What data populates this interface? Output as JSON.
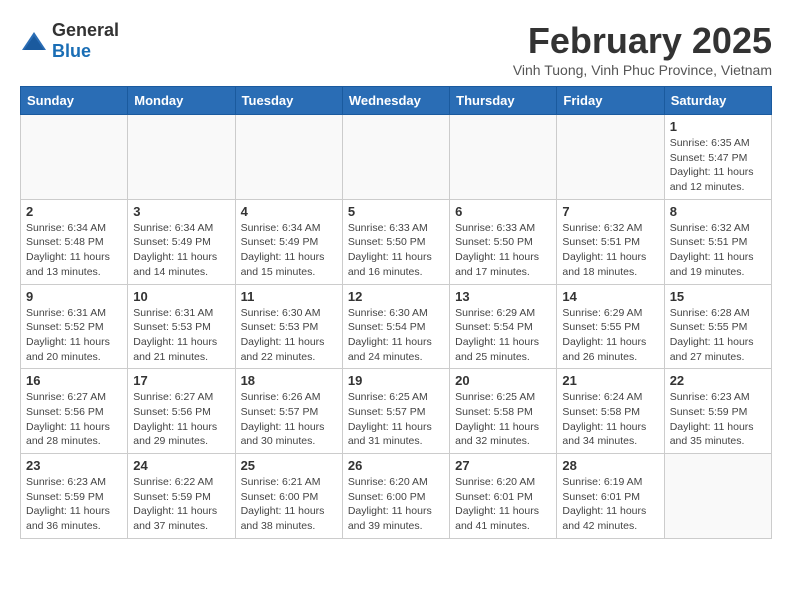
{
  "logo": {
    "general": "General",
    "blue": "Blue"
  },
  "title": "February 2025",
  "subtitle": "Vinh Tuong, Vinh Phuc Province, Vietnam",
  "days_of_week": [
    "Sunday",
    "Monday",
    "Tuesday",
    "Wednesday",
    "Thursday",
    "Friday",
    "Saturday"
  ],
  "weeks": [
    [
      {
        "day": "",
        "info": ""
      },
      {
        "day": "",
        "info": ""
      },
      {
        "day": "",
        "info": ""
      },
      {
        "day": "",
        "info": ""
      },
      {
        "day": "",
        "info": ""
      },
      {
        "day": "",
        "info": ""
      },
      {
        "day": "1",
        "info": "Sunrise: 6:35 AM\nSunset: 5:47 PM\nDaylight: 11 hours\nand 12 minutes."
      }
    ],
    [
      {
        "day": "2",
        "info": "Sunrise: 6:34 AM\nSunset: 5:48 PM\nDaylight: 11 hours\nand 13 minutes."
      },
      {
        "day": "3",
        "info": "Sunrise: 6:34 AM\nSunset: 5:49 PM\nDaylight: 11 hours\nand 14 minutes."
      },
      {
        "day": "4",
        "info": "Sunrise: 6:34 AM\nSunset: 5:49 PM\nDaylight: 11 hours\nand 15 minutes."
      },
      {
        "day": "5",
        "info": "Sunrise: 6:33 AM\nSunset: 5:50 PM\nDaylight: 11 hours\nand 16 minutes."
      },
      {
        "day": "6",
        "info": "Sunrise: 6:33 AM\nSunset: 5:50 PM\nDaylight: 11 hours\nand 17 minutes."
      },
      {
        "day": "7",
        "info": "Sunrise: 6:32 AM\nSunset: 5:51 PM\nDaylight: 11 hours\nand 18 minutes."
      },
      {
        "day": "8",
        "info": "Sunrise: 6:32 AM\nSunset: 5:51 PM\nDaylight: 11 hours\nand 19 minutes."
      }
    ],
    [
      {
        "day": "9",
        "info": "Sunrise: 6:31 AM\nSunset: 5:52 PM\nDaylight: 11 hours\nand 20 minutes."
      },
      {
        "day": "10",
        "info": "Sunrise: 6:31 AM\nSunset: 5:53 PM\nDaylight: 11 hours\nand 21 minutes."
      },
      {
        "day": "11",
        "info": "Sunrise: 6:30 AM\nSunset: 5:53 PM\nDaylight: 11 hours\nand 22 minutes."
      },
      {
        "day": "12",
        "info": "Sunrise: 6:30 AM\nSunset: 5:54 PM\nDaylight: 11 hours\nand 24 minutes."
      },
      {
        "day": "13",
        "info": "Sunrise: 6:29 AM\nSunset: 5:54 PM\nDaylight: 11 hours\nand 25 minutes."
      },
      {
        "day": "14",
        "info": "Sunrise: 6:29 AM\nSunset: 5:55 PM\nDaylight: 11 hours\nand 26 minutes."
      },
      {
        "day": "15",
        "info": "Sunrise: 6:28 AM\nSunset: 5:55 PM\nDaylight: 11 hours\nand 27 minutes."
      }
    ],
    [
      {
        "day": "16",
        "info": "Sunrise: 6:27 AM\nSunset: 5:56 PM\nDaylight: 11 hours\nand 28 minutes."
      },
      {
        "day": "17",
        "info": "Sunrise: 6:27 AM\nSunset: 5:56 PM\nDaylight: 11 hours\nand 29 minutes."
      },
      {
        "day": "18",
        "info": "Sunrise: 6:26 AM\nSunset: 5:57 PM\nDaylight: 11 hours\nand 30 minutes."
      },
      {
        "day": "19",
        "info": "Sunrise: 6:25 AM\nSunset: 5:57 PM\nDaylight: 11 hours\nand 31 minutes."
      },
      {
        "day": "20",
        "info": "Sunrise: 6:25 AM\nSunset: 5:58 PM\nDaylight: 11 hours\nand 32 minutes."
      },
      {
        "day": "21",
        "info": "Sunrise: 6:24 AM\nSunset: 5:58 PM\nDaylight: 11 hours\nand 34 minutes."
      },
      {
        "day": "22",
        "info": "Sunrise: 6:23 AM\nSunset: 5:59 PM\nDaylight: 11 hours\nand 35 minutes."
      }
    ],
    [
      {
        "day": "23",
        "info": "Sunrise: 6:23 AM\nSunset: 5:59 PM\nDaylight: 11 hours\nand 36 minutes."
      },
      {
        "day": "24",
        "info": "Sunrise: 6:22 AM\nSunset: 5:59 PM\nDaylight: 11 hours\nand 37 minutes."
      },
      {
        "day": "25",
        "info": "Sunrise: 6:21 AM\nSunset: 6:00 PM\nDaylight: 11 hours\nand 38 minutes."
      },
      {
        "day": "26",
        "info": "Sunrise: 6:20 AM\nSunset: 6:00 PM\nDaylight: 11 hours\nand 39 minutes."
      },
      {
        "day": "27",
        "info": "Sunrise: 6:20 AM\nSunset: 6:01 PM\nDaylight: 11 hours\nand 41 minutes."
      },
      {
        "day": "28",
        "info": "Sunrise: 6:19 AM\nSunset: 6:01 PM\nDaylight: 11 hours\nand 42 minutes."
      },
      {
        "day": "",
        "info": ""
      }
    ]
  ]
}
